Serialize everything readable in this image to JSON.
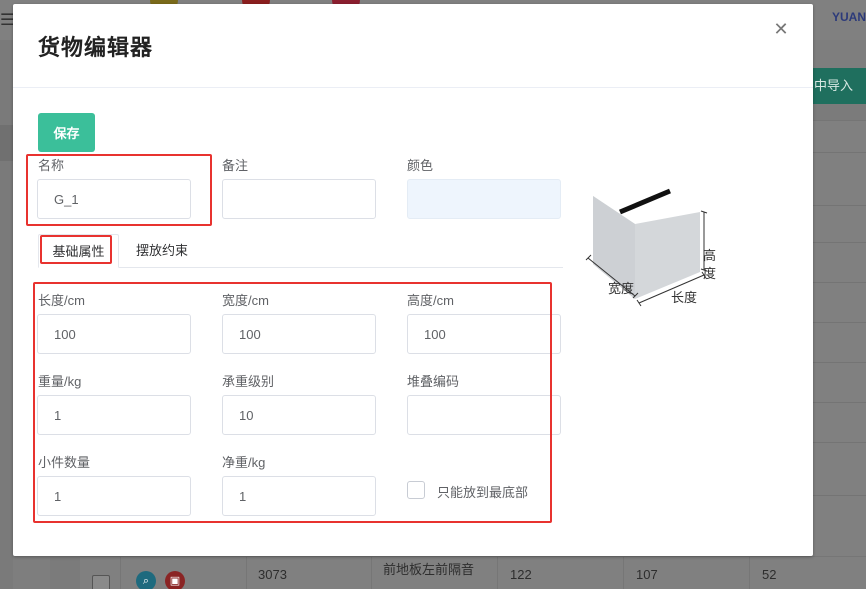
{
  "background": {
    "menu_icon": "hamburger-icon",
    "avatar_colors": [
      "#7a6a1a",
      "#8b1f1f",
      "#8b1f2f"
    ],
    "user_label": "YUAN",
    "import_label": "中导入",
    "bottom_row": {
      "id": "3073",
      "name": "前地板左前隔音",
      "col1": "122",
      "col2": "107",
      "col3": "52"
    },
    "row_icons": [
      "search-icon",
      "delete-icon"
    ]
  },
  "dialog": {
    "title": "货物编辑器",
    "close_glyph": "✕",
    "save_label": "保存",
    "fields": {
      "name": {
        "label": "名称",
        "value": "G_1"
      },
      "remark": {
        "label": "备注",
        "value": ""
      },
      "color": {
        "label": "颜色",
        "value": ""
      }
    },
    "tabs": [
      "基础属性",
      "摆放约束"
    ],
    "attributes": {
      "length": {
        "label": "长度/cm",
        "value": "100"
      },
      "width": {
        "label": "宽度/cm",
        "value": "100"
      },
      "height": {
        "label": "高度/cm",
        "value": "100"
      },
      "weight": {
        "label": "重量/kg",
        "value": "1"
      },
      "load_level": {
        "label": "承重级别",
        "value": "10"
      },
      "stack_code": {
        "label": "堆叠编码",
        "value": ""
      },
      "piece_count": {
        "label": "小件数量",
        "value": "1"
      },
      "net_weight": {
        "label": "净重/kg",
        "value": "1"
      },
      "bottom_only": {
        "label": "只能放到最底部",
        "checked": false
      }
    },
    "diagram": {
      "height_label_1": "高",
      "height_label_2": "度",
      "width_label": "宽度",
      "length_label": "长度"
    }
  },
  "colors": {
    "accent": "#3bbf9a",
    "highlight": "#e8322f",
    "color_field": "#eef5fd"
  }
}
